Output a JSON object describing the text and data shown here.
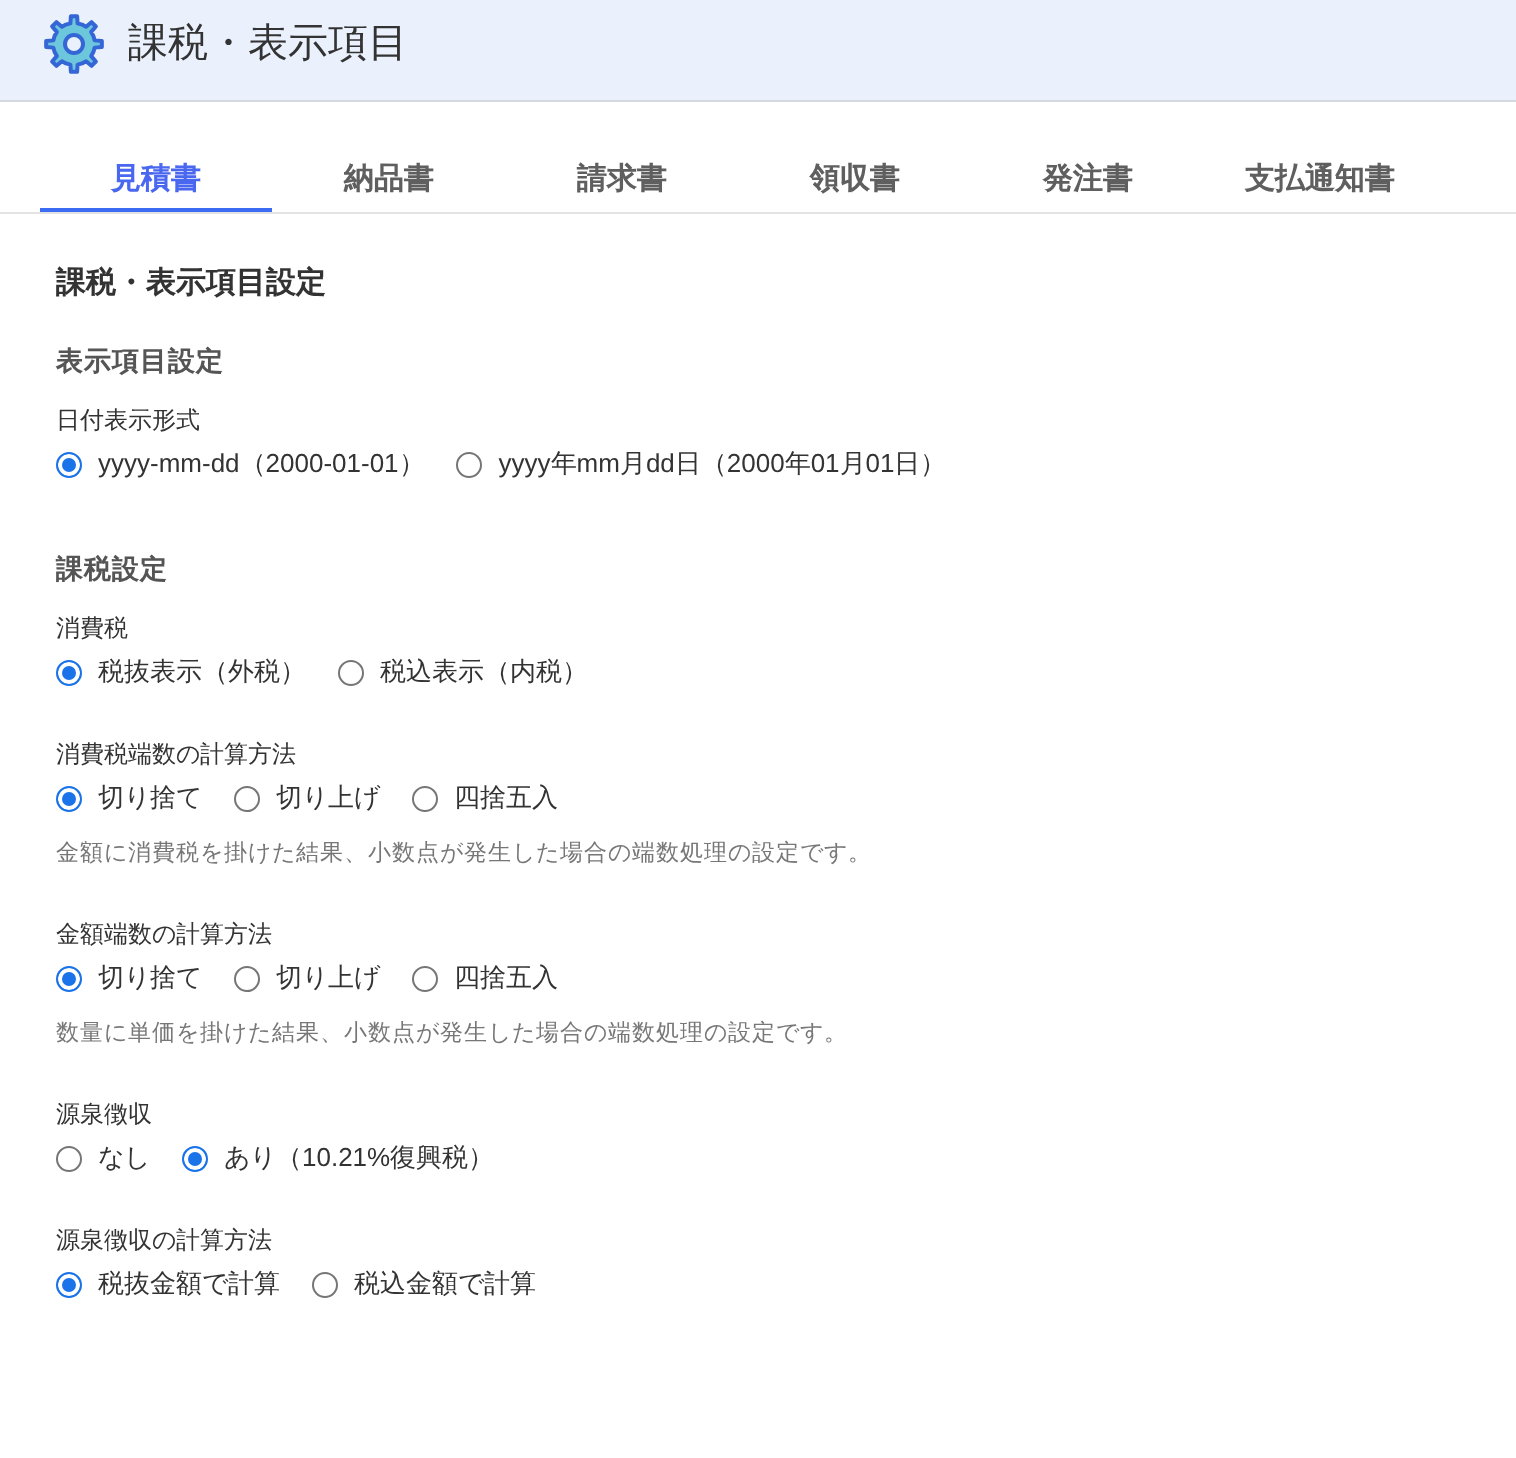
{
  "header": {
    "title": "課税・表示項目"
  },
  "tabs": [
    {
      "label": "見積書",
      "selected": true
    },
    {
      "label": "納品書",
      "selected": false
    },
    {
      "label": "請求書",
      "selected": false
    },
    {
      "label": "領収書",
      "selected": false
    },
    {
      "label": "発注書",
      "selected": false
    },
    {
      "label": "支払通知書",
      "selected": false
    }
  ],
  "section_title": "課税・表示項目設定",
  "groups": [
    {
      "heading": "表示項目設定",
      "fields": [
        {
          "label": "日付表示形式",
          "options": [
            {
              "label": "yyyy-mm-dd（2000-01-01）",
              "selected": true
            },
            {
              "label": "yyyy年mm月dd日（2000年01月01日）",
              "selected": false
            }
          ]
        }
      ]
    },
    {
      "heading": "課税設定",
      "fields": [
        {
          "label": "消費税",
          "options": [
            {
              "label": "税抜表示（外税）",
              "selected": true
            },
            {
              "label": "税込表示（内税）",
              "selected": false
            }
          ]
        },
        {
          "label": "消費税端数の計算方法",
          "options": [
            {
              "label": "切り捨て",
              "selected": true
            },
            {
              "label": "切り上げ",
              "selected": false
            },
            {
              "label": "四捨五入",
              "selected": false
            }
          ],
          "hint": "金額に消費税を掛けた結果、小数点が発生した場合の端数処理の設定です。"
        },
        {
          "label": "金額端数の計算方法",
          "options": [
            {
              "label": "切り捨て",
              "selected": true
            },
            {
              "label": "切り上げ",
              "selected": false
            },
            {
              "label": "四捨五入",
              "selected": false
            }
          ],
          "hint": "数量に単価を掛けた結果、小数点が発生した場合の端数処理の設定です。"
        },
        {
          "label": "源泉徴収",
          "options": [
            {
              "label": "なし",
              "selected": false
            },
            {
              "label": "あり（10.21%復興税）",
              "selected": true
            }
          ]
        },
        {
          "label": "源泉徴収の計算方法",
          "options": [
            {
              "label": "税抜金額で計算",
              "selected": true
            },
            {
              "label": "税込金額で計算",
              "selected": false
            }
          ]
        }
      ]
    }
  ]
}
